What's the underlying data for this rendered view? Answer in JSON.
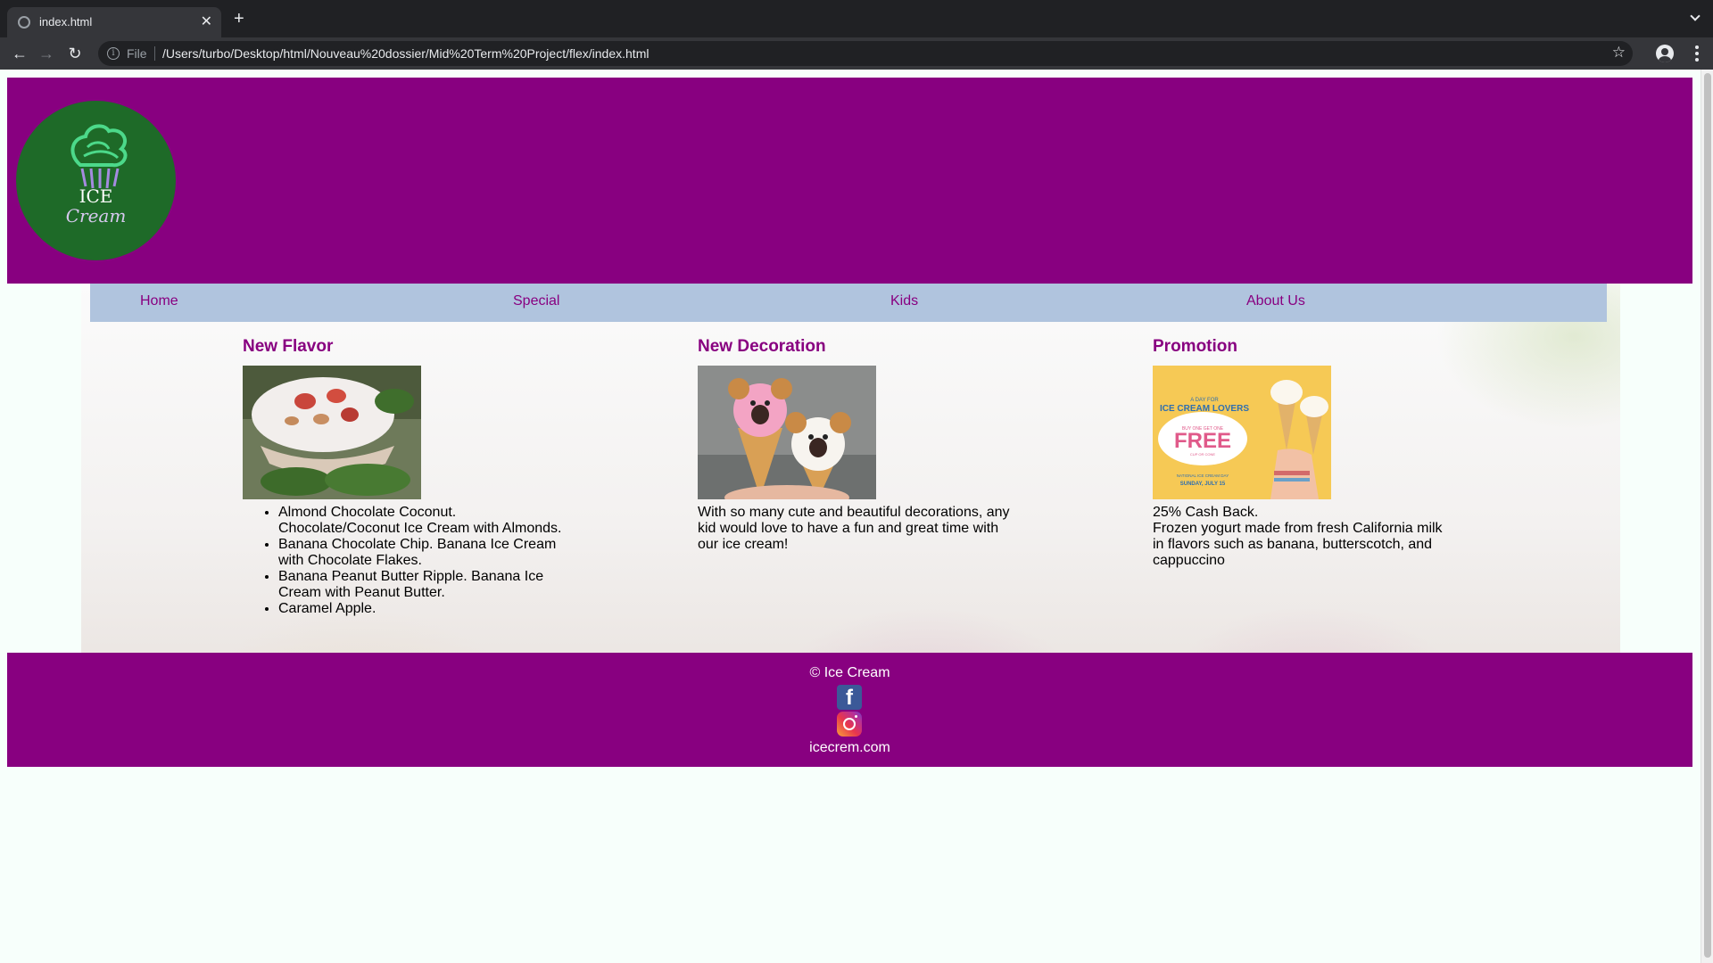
{
  "browser": {
    "tab_title": "index.html",
    "new_tab_label": "+",
    "scheme_label": "File",
    "url": "/Users/turbo/Desktop/html/Nouveau%20dossier/Mid%20Term%20Project/flex/index.html",
    "icons": [
      "globe-icon",
      "close-icon",
      "plus-icon",
      "back-icon",
      "forward-icon",
      "reload-icon",
      "info-icon",
      "star-icon",
      "profile-icon",
      "menu-icon",
      "chevron-down-icon"
    ]
  },
  "header": {
    "logo_line1": "ICE",
    "logo_line2": "Cream",
    "colors": {
      "header_bg": "#880080",
      "logo_bg": "#1e6a28",
      "logo_swirl": "#4cd98a"
    }
  },
  "nav": {
    "items": [
      "Home",
      "Special",
      "Kids",
      "About Us"
    ],
    "colors": {
      "bar_bg": "#b0c4de",
      "link": "#880080"
    }
  },
  "sections": {
    "new_flavor": {
      "title": "New Flavor",
      "items": [
        "Almond Chocolate Coconut. Chocolate/Coconut Ice Cream with Almonds.",
        "Banana Chocolate Chip. Banana Ice Cream with Chocolate Flakes.",
        "Banana Peanut Butter Ripple. Banana Ice Cream with Peanut Butter.",
        "Caramel Apple."
      ]
    },
    "new_decoration": {
      "title": "New Decoration",
      "text": "With so many cute and beautiful decorations, any kid would love to have a fun and great time with our ice cream!"
    },
    "promotion": {
      "title": "Promotion",
      "line1": "25% Cash Back.",
      "line2": "Frozen yogurt made from fresh California milk in flavors such as banana, butterscotch, and cappuccino",
      "poster": {
        "heading1": "A DAY FOR",
        "heading2": "ICE CREAM LOVERS",
        "offer": "BUY ONE GET ONE",
        "free": "FREE",
        "cup": "CUP OR CONE",
        "event": "NATIONAL ICE CREAM DAY",
        "date": "SUNDAY, JULY 15"
      }
    }
  },
  "footer": {
    "copyright": "© Ice Cream",
    "site": "icecrem.com",
    "colors": {
      "bg": "#880080",
      "text": "#ffffff"
    }
  }
}
